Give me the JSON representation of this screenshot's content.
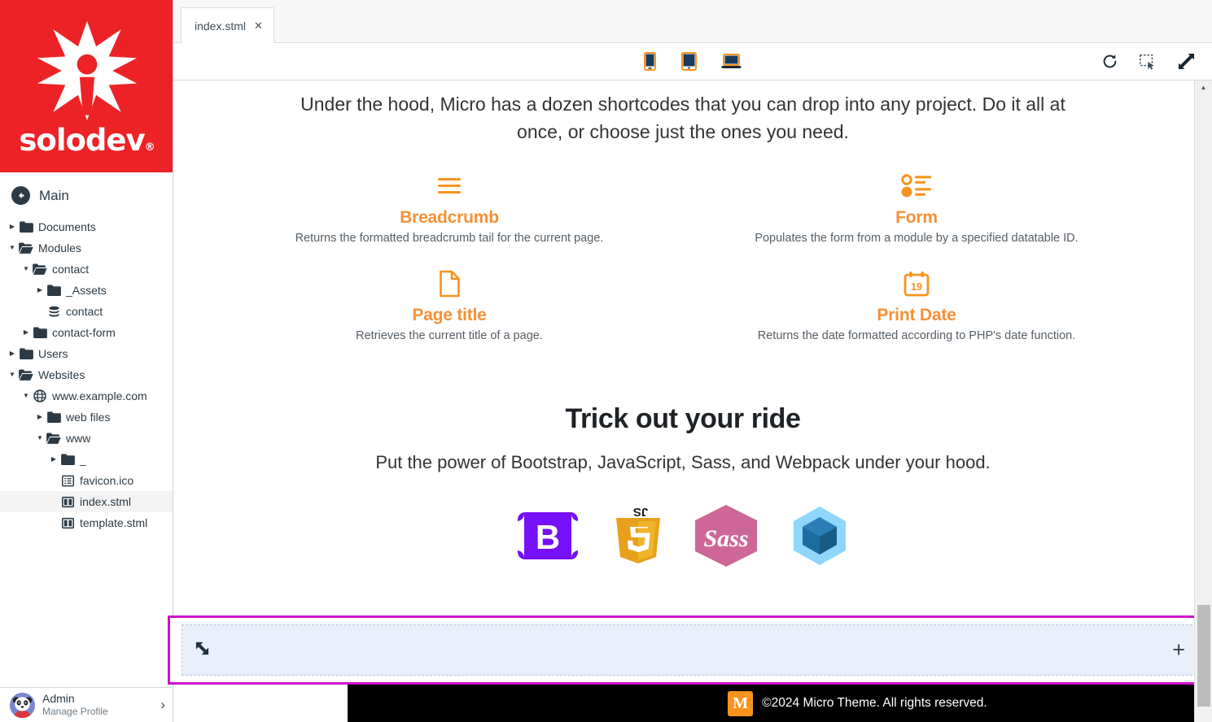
{
  "brand": {
    "name": "solodev",
    "registered_mark": "®",
    "logo_icon": "solodev-starburst-icon",
    "background_color": "#ec2227"
  },
  "sidebar": {
    "nav_header": {
      "back_icon": "back-arrow-icon",
      "title": "Main"
    },
    "tree": [
      {
        "label": "Documents",
        "icon": "folder-closed-icon",
        "twisty": "collapsed",
        "depth": 0,
        "selected": false
      },
      {
        "label": "Modules",
        "icon": "folder-open-icon",
        "twisty": "expanded",
        "depth": 0,
        "selected": false
      },
      {
        "label": "contact",
        "icon": "folder-open-icon",
        "twisty": "expanded",
        "depth": 1,
        "selected": false
      },
      {
        "label": "_Assets",
        "icon": "folder-closed-icon",
        "twisty": "collapsed",
        "depth": 2,
        "selected": false
      },
      {
        "label": "contact",
        "icon": "database-icon",
        "twisty": "none",
        "depth": 2,
        "selected": false
      },
      {
        "label": "contact-form",
        "icon": "folder-closed-icon",
        "twisty": "collapsed",
        "depth": 1,
        "selected": false
      },
      {
        "label": "Users",
        "icon": "folder-closed-icon",
        "twisty": "collapsed",
        "depth": 0,
        "selected": false
      },
      {
        "label": "Websites",
        "icon": "folder-open-icon",
        "twisty": "expanded",
        "depth": 0,
        "selected": false
      },
      {
        "label": "www.example.com",
        "icon": "globe-icon",
        "twisty": "expanded",
        "depth": 1,
        "selected": false
      },
      {
        "label": "web files",
        "icon": "folder-closed-icon",
        "twisty": "collapsed",
        "depth": 2,
        "selected": false
      },
      {
        "label": "www",
        "icon": "folder-open-icon",
        "twisty": "expanded",
        "depth": 2,
        "selected": false
      },
      {
        "label": "_",
        "icon": "folder-closed-icon",
        "twisty": "collapsed",
        "depth": 3,
        "selected": false
      },
      {
        "label": "favicon.ico",
        "icon": "file-list-icon",
        "twisty": "none",
        "depth": 3,
        "selected": false
      },
      {
        "label": "index.stml",
        "icon": "page-layout-icon",
        "twisty": "none",
        "depth": 3,
        "selected": true
      },
      {
        "label": "template.stml",
        "icon": "page-layout-icon",
        "twisty": "none",
        "depth": 3,
        "selected": false
      }
    ],
    "user": {
      "name": "Admin",
      "subtitle": "Manage Profile",
      "avatar_icon": "panda-avatar",
      "chevron_icon": "chevron-right-icon"
    }
  },
  "tabs": [
    {
      "label": "index.stml",
      "close_icon": "close-icon",
      "active": true
    }
  ],
  "toolbar": {
    "devices": [
      {
        "name": "mobile-preview",
        "icon": "phone-icon"
      },
      {
        "name": "tablet-preview",
        "icon": "tablet-icon"
      },
      {
        "name": "desktop-preview",
        "icon": "laptop-icon"
      }
    ],
    "actions": [
      {
        "name": "refresh-button",
        "icon": "refresh-icon"
      },
      {
        "name": "select-region-button",
        "icon": "marquee-select-icon"
      },
      {
        "name": "fullscreen-button",
        "icon": "expand-arrows-icon"
      }
    ]
  },
  "page": {
    "lead": "Under the hood, Micro has a dozen shortcodes that you can drop into any project. Do it all at once, or choose just the ones you need.",
    "shortcodes": [
      {
        "icon": "hamburger-lines-icon",
        "title": "Breadcrumb",
        "description": "Returns the formatted breadcrumb tail for the current page."
      },
      {
        "icon": "radio-list-icon",
        "title": "Form",
        "description": "Populates the form from a module by a specified datatable ID."
      },
      {
        "icon": "document-icon",
        "title": "Page title",
        "description": "Retrieves the current title of a page."
      },
      {
        "icon": "calendar-icon",
        "title": "Print Date",
        "description": "Returns the date formatted according to PHP's date function.",
        "calendar_day": "19"
      }
    ],
    "section2": {
      "heading": "Trick out your ride",
      "subheading": "Put the power of Bootstrap, JavaScript, Sass, and Webpack under your hood.",
      "logos": [
        {
          "name": "bootstrap-logo",
          "label": "B",
          "color": "#7610f9"
        },
        {
          "name": "javascript-logo",
          "label": "5",
          "color": "#e8a01c",
          "badge": "JS"
        },
        {
          "name": "sass-logo",
          "label": "Sass",
          "color": "#cd6799"
        },
        {
          "name": "webpack-logo",
          "label": "",
          "color": "#8ed6fb"
        }
      ]
    },
    "footer": {
      "logo_letter": "M",
      "text": "©2024 Micro Theme. All rights reserved."
    }
  },
  "dropzone": {
    "handle_icon": "resize-corner-icon",
    "add_icon": "plus-icon",
    "border_color": "#d010d0",
    "fill_color": "#eaf0fb"
  },
  "colors": {
    "brand_red": "#ec2227",
    "accent_orange": "#f79035",
    "dark_text": "#2b3a45"
  }
}
